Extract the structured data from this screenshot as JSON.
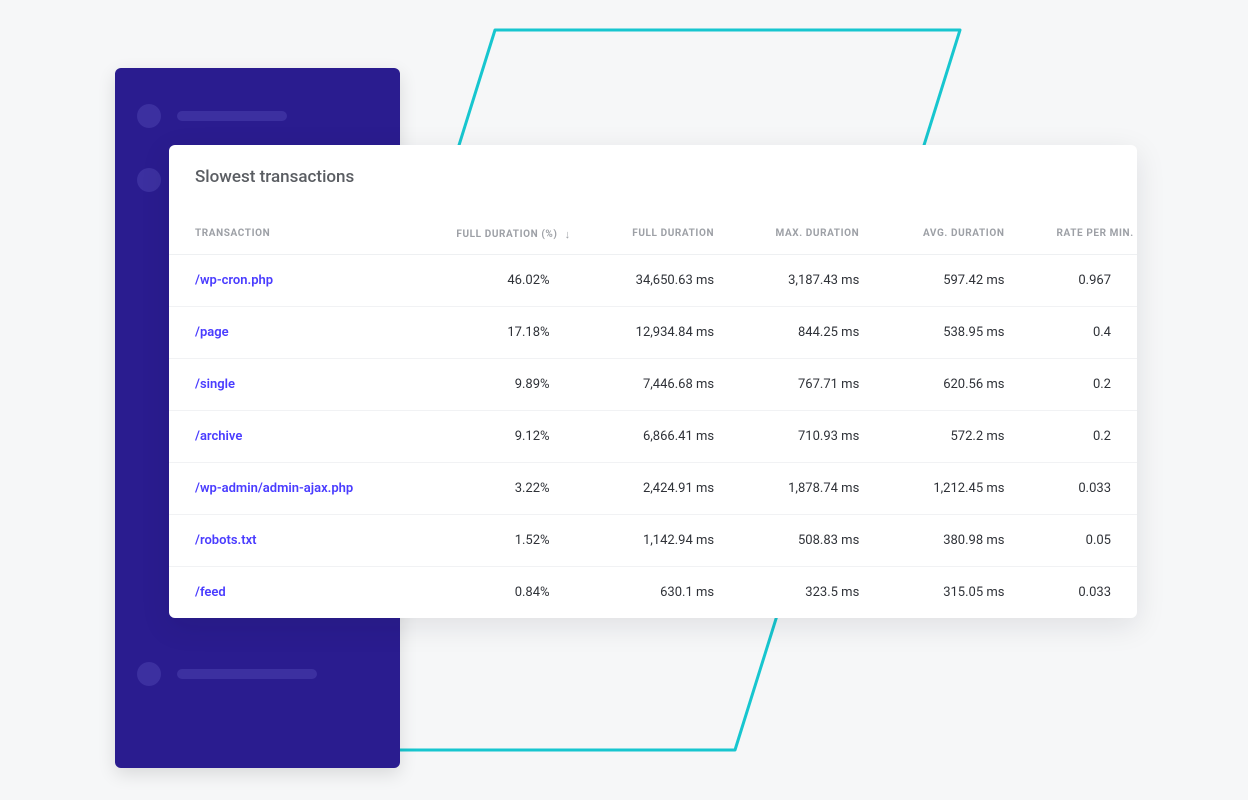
{
  "card": {
    "title": "Slowest transactions"
  },
  "columns": {
    "transaction": "TRANSACTION",
    "full_pct": "FULL DURATION (%)",
    "full_dur": "FULL DURATION",
    "max_dur": "MAX. DURATION",
    "avg_dur": "AVG. DURATION",
    "rate": "RATE PER MIN."
  },
  "sort": {
    "column": "full_pct",
    "indicator": "↓"
  },
  "rows": [
    {
      "transaction": "/wp-cron.php",
      "full_pct": "46.02%",
      "full_dur": "34,650.63 ms",
      "max_dur": "3,187.43 ms",
      "avg_dur": "597.42 ms",
      "rate": "0.967"
    },
    {
      "transaction": "/page",
      "full_pct": "17.18%",
      "full_dur": "12,934.84 ms",
      "max_dur": "844.25 ms",
      "avg_dur": "538.95 ms",
      "rate": "0.4"
    },
    {
      "transaction": "/single",
      "full_pct": "9.89%",
      "full_dur": "7,446.68 ms",
      "max_dur": "767.71 ms",
      "avg_dur": "620.56 ms",
      "rate": "0.2"
    },
    {
      "transaction": "/archive",
      "full_pct": "9.12%",
      "full_dur": "6,866.41 ms",
      "max_dur": "710.93 ms",
      "avg_dur": "572.2 ms",
      "rate": "0.2"
    },
    {
      "transaction": "/wp-admin/admin-ajax.php",
      "full_pct": "3.22%",
      "full_dur": "2,424.91 ms",
      "max_dur": "1,878.74 ms",
      "avg_dur": "1,212.45 ms",
      "rate": "0.033"
    },
    {
      "transaction": "/robots.txt",
      "full_pct": "1.52%",
      "full_dur": "1,142.94 ms",
      "max_dur": "508.83 ms",
      "avg_dur": "380.98 ms",
      "rate": "0.05"
    },
    {
      "transaction": "/feed",
      "full_pct": "0.84%",
      "full_dur": "630.1 ms",
      "max_dur": "323.5 ms",
      "avg_dur": "315.05 ms",
      "rate": "0.033"
    }
  ]
}
